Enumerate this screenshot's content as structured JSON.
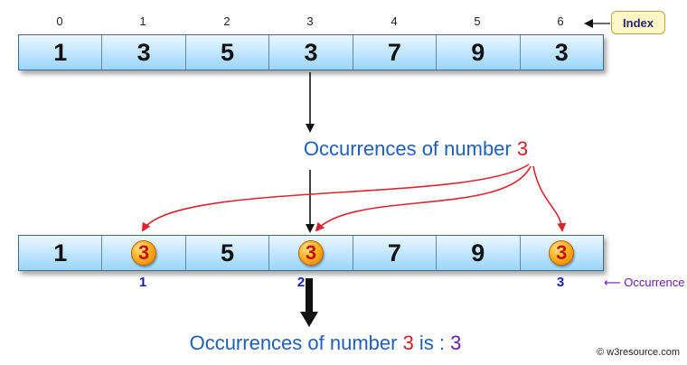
{
  "indices": [
    "0",
    "1",
    "2",
    "3",
    "4",
    "5",
    "6"
  ],
  "index_label": "Index",
  "top_array": [
    "1",
    "3",
    "5",
    "3",
    "7",
    "9",
    "3"
  ],
  "occurrence_title": {
    "prefix": "Occurrences of number ",
    "number": "3"
  },
  "bottom_array": [
    {
      "value": "1",
      "highlighted": false
    },
    {
      "value": "3",
      "highlighted": true
    },
    {
      "value": "5",
      "highlighted": false
    },
    {
      "value": "3",
      "highlighted": true
    },
    {
      "value": "7",
      "highlighted": false
    },
    {
      "value": "9",
      "highlighted": false
    },
    {
      "value": "3",
      "highlighted": true
    }
  ],
  "occurrence_positions": [
    "1",
    "2",
    "3"
  ],
  "occurrence_label": "Occurrence",
  "result": {
    "prefix": "Occurrences of number ",
    "number": "3",
    "middle": " is : ",
    "count": "3"
  },
  "copyright": "© w3resource.com",
  "colors": {
    "cell_top": "#eaf7ff",
    "cell_bottom": "#99d5fb",
    "arrow_red": "#d9262e",
    "text_blue": "#1f5fb8",
    "accent_red": "#c8202b",
    "accent_purple": "#6a1ba8"
  }
}
